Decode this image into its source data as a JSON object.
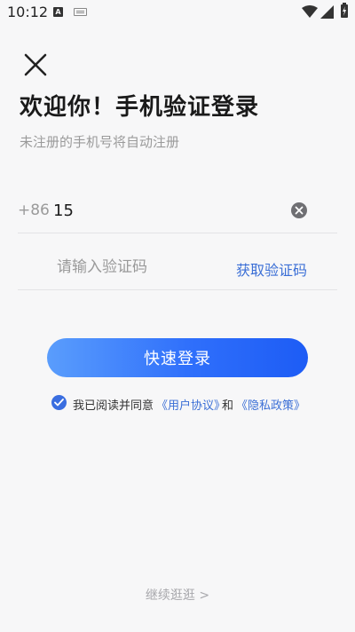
{
  "status_bar": {
    "time": "10:12",
    "icons": [
      "a-icon",
      "keyboard-icon",
      "wifi-icon",
      "signal-icon",
      "battery-charging-icon"
    ]
  },
  "header": {
    "close_icon": "close-icon",
    "title": "欢迎你！手机验证登录",
    "subtitle": "未注册的手机号将自动注册"
  },
  "form": {
    "country_code": "+86",
    "phone_value": "15",
    "clear_icon": "clear-circle-icon",
    "code_placeholder": "请输入验证码",
    "get_code_label": "获取验证码",
    "login_label": "快速登录"
  },
  "agreement": {
    "checked": true,
    "prefix": "我已阅读并同意",
    "user_agreement": "《用户协议》",
    "and": "和",
    "privacy_policy": "《隐私政策》"
  },
  "footer": {
    "browse_label": "继续逛逛 >"
  },
  "colors": {
    "accent": "#2f6ffb",
    "link": "#3b6fd6",
    "background": "#f7f7f8"
  }
}
